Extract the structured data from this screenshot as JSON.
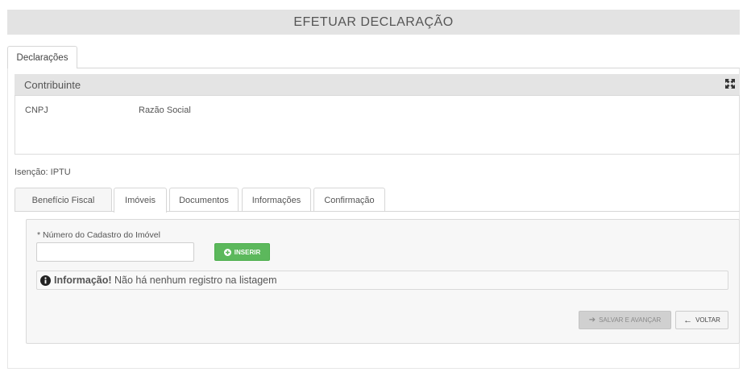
{
  "header": {
    "title": "EFETUAR DECLARAÇÃO"
  },
  "outer_tabs": [
    {
      "label": "Declarações"
    }
  ],
  "contribuinte": {
    "title": "Contribuinte",
    "fields": [
      {
        "label": "CNPJ"
      },
      {
        "label": "Razão Social"
      }
    ],
    "icon": "expand-icon"
  },
  "isencao": "Isenção: IPTU",
  "section_tabs": [
    {
      "label": "Benefício Fiscal"
    },
    {
      "label": "Imóveis",
      "active": true
    },
    {
      "label": "Documentos"
    },
    {
      "label": "Informações"
    },
    {
      "label": "Confirmação"
    }
  ],
  "form": {
    "field_label": "* Número do Cadastro do Imóvel",
    "field_value": "",
    "field_placeholder": "",
    "insert_button": "INSERIR",
    "info_title": "Informação!",
    "info_message": " Não há nenhum registro na listagem",
    "save_button": "SALVAR E AVANÇAR",
    "back_button": "VOLTAR"
  },
  "colors": {
    "success": "#5cb85c",
    "header_bg": "#e3e3e3"
  }
}
